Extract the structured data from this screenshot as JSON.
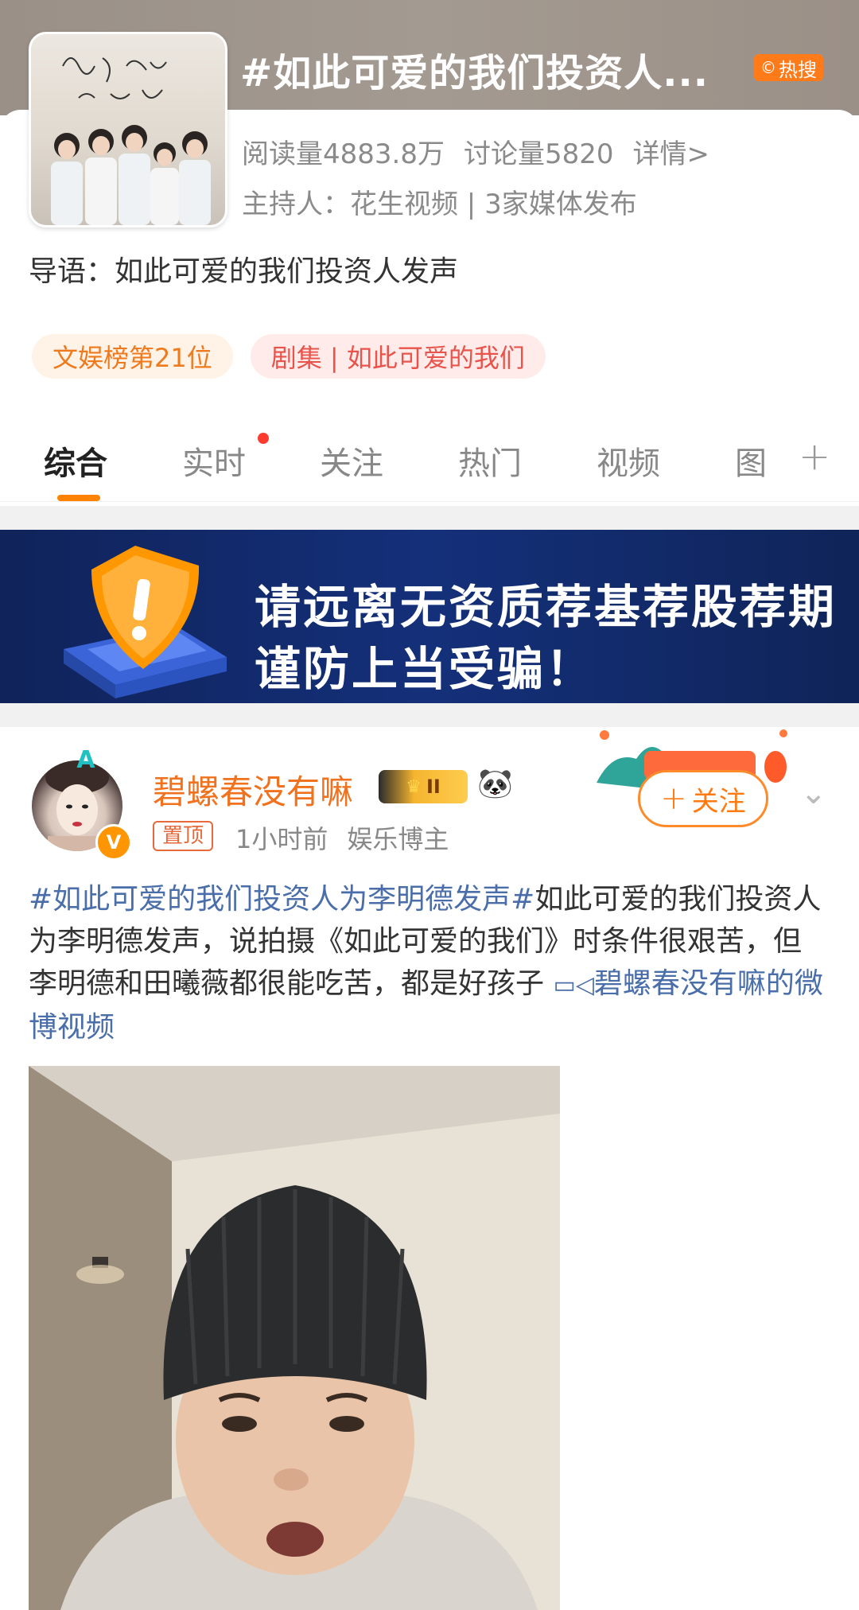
{
  "topic": {
    "title": "#如此可爱的我们投资人...",
    "hot_badge": "热搜",
    "reads": "阅读量4883.8万",
    "discussion": "讨论量5820",
    "details": "详情>",
    "host": "主持人：花生视频 | 3家媒体发布",
    "intro": "导语：如此可爱的我们投资人发声",
    "tags": [
      "文娱榜第21位",
      "剧集 | 如此可爱的我们"
    ]
  },
  "tabs": [
    "综合",
    "实时",
    "关注",
    "热门",
    "视频",
    "图"
  ],
  "banner": {
    "line1": "请远离无资质荐基荐股荐期",
    "line2": "谨防上当受骗！"
  },
  "post": {
    "username": "碧螺春没有嘛",
    "vip_level": "II",
    "pinned": "置顶",
    "time": "1小时前",
    "role": "娱乐博主",
    "follow": "关注",
    "hashtag": "#如此可爱的我们投资人为李明德发声#",
    "body": "如此可爱的我们投资人为李明德发声，说拍摄《如此可爱的我们》时条件很艰苦，但李明德和田曦薇都很能吃苦，都是好孩子",
    "video_link": "碧螺春没有嘛的微博视频"
  },
  "colors": {
    "accent": "#ff8200",
    "username": "#f0721e",
    "link": "#4a6ea9",
    "banner_bg": "#14307a"
  },
  "icons": [
    "hot-search-icon",
    "plus-icon",
    "shield-warning-icon",
    "verified-v-icon",
    "vip-crown-icon",
    "panda-icon",
    "chevron-down-icon",
    "video-camera-icon"
  ]
}
